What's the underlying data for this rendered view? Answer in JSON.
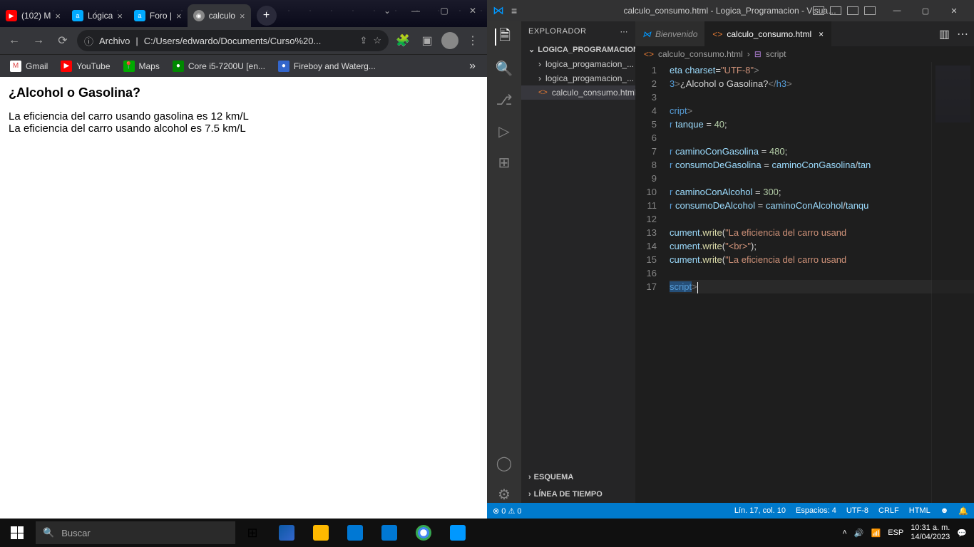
{
  "chrome": {
    "tabs": [
      {
        "title": "(102) M",
        "icon": "yt"
      },
      {
        "title": "Lógica",
        "icon": "alura"
      },
      {
        "title": "Foro |",
        "icon": "alura"
      },
      {
        "title": "calculo",
        "icon": "glob",
        "active": true
      }
    ],
    "address": {
      "scheme": "Archivo",
      "url": "C:/Users/edwardo/Documents/Curso%20..."
    },
    "bookmarks": [
      {
        "label": "Gmail",
        "icon": "gm"
      },
      {
        "label": "YouTube",
        "icon": "yt2"
      },
      {
        "label": "Maps",
        "icon": "mp"
      },
      {
        "label": "Core i5-7200U [en...",
        "icon": "ci"
      },
      {
        "label": "Fireboy and Waterg...",
        "icon": "fb"
      }
    ],
    "page": {
      "heading": "¿Alcohol o Gasolina?",
      "line1": "La eficiencia del carro usando gasolina es 12 km/L",
      "line2": "La eficiencia del carro usando alcohol es 7.5 km/L"
    }
  },
  "vscode": {
    "title": "calculo_consumo.html - Logica_Programacion - Visual Stu...",
    "explorer": {
      "title": "EXPLORADOR",
      "project": "LOGICA_PROGRAMACION",
      "files": [
        {
          "name": "logica_progamacion_..."
        },
        {
          "name": "logica_progamacion_..."
        },
        {
          "name": "calculo_consumo.html",
          "active": true
        }
      ],
      "outline": "ESQUEMA",
      "timeline": "LÍNEA DE TIEMPO"
    },
    "editor_tabs": [
      {
        "label": "Bienvenido",
        "icon": "vs"
      },
      {
        "label": "calculo_consumo.html",
        "icon": "html",
        "active": true
      }
    ],
    "breadcrumb": {
      "file": "calculo_consumo.html",
      "symbol": "script"
    },
    "code": {
      "lines": [
        {
          "n": 1,
          "html": "<span class='c-attr'>eta</span> <span class='c-attr'>charset</span><span class='c-op'>=</span><span class='c-str'>\"UTF-8\"</span><span class='c-tag'>&gt;</span>"
        },
        {
          "n": 2,
          "html": "<span class='c-tagn'>3</span><span class='c-tag'>&gt;</span><span class='c-text'>¿Alcohol o Gasolina?</span><span class='c-tag'>&lt;/</span><span class='c-tagn'>h3</span><span class='c-tag'>&gt;</span>"
        },
        {
          "n": 3,
          "html": ""
        },
        {
          "n": 4,
          "html": "<span class='c-tagn'>cript</span><span class='c-tag'>&gt;</span>"
        },
        {
          "n": 5,
          "html": "<span class='c-kw'>r</span> <span class='c-var'>tanque</span> <span class='c-op'>=</span> <span class='c-num'>40</span><span class='c-op'>;</span>"
        },
        {
          "n": 6,
          "html": ""
        },
        {
          "n": 7,
          "html": "<span class='c-kw'>r</span> <span class='c-var'>caminoConGasolina</span> <span class='c-op'>=</span> <span class='c-num'>480</span><span class='c-op'>;</span>"
        },
        {
          "n": 8,
          "html": "<span class='c-kw'>r</span> <span class='c-var'>consumoDeGasolina</span> <span class='c-op'>=</span> <span class='c-var'>caminoConGasolina</span><span class='c-op'>/</span><span class='c-var'>tan</span>"
        },
        {
          "n": 9,
          "html": ""
        },
        {
          "n": 10,
          "html": "<span class='c-kw'>r</span> <span class='c-var'>caminoConAlcohol</span> <span class='c-op'>=</span> <span class='c-num'>300</span><span class='c-op'>;</span>"
        },
        {
          "n": 11,
          "html": "<span class='c-kw'>r</span> <span class='c-var'>consumoDeAlcohol</span> <span class='c-op'>=</span> <span class='c-var'>caminoConAlcohol</span><span class='c-op'>/</span><span class='c-var'>tanqu</span>"
        },
        {
          "n": 12,
          "html": ""
        },
        {
          "n": 13,
          "html": "<span class='c-obj'>cument</span><span class='c-op'>.</span><span class='c-fn'>write</span><span class='c-op'>(</span><span class='c-str'>\"La eficiencia del carro usand</span>"
        },
        {
          "n": 14,
          "html": "<span class='c-obj'>cument</span><span class='c-op'>.</span><span class='c-fn'>write</span><span class='c-op'>(</span><span class='c-str'>\"&lt;br&gt;\"</span><span class='c-op'>);</span>"
        },
        {
          "n": 15,
          "html": "<span class='c-obj'>cument</span><span class='c-op'>.</span><span class='c-fn'>write</span><span class='c-op'>(</span><span class='c-str'>\"La eficiencia del carro usand</span>"
        },
        {
          "n": 16,
          "html": ""
        },
        {
          "n": 17,
          "html": "<span class='c-tagn' style='background:#264f78'>script</span><span class='c-tag'>&gt;</span><span style='border-left:1px solid #fff;height:16px;display:inline-block;vertical-align:middle'></span>",
          "cursor": true
        }
      ]
    },
    "status": {
      "errors": "⊗ 0 ⚠ 0",
      "position": "Lín. 17, col. 10",
      "spaces": "Espacios: 4",
      "encoding": "UTF-8",
      "eol": "CRLF",
      "lang": "HTML"
    }
  },
  "taskbar": {
    "search_placeholder": "Buscar",
    "time": "10:31 a. m.",
    "date": "14/04/2023"
  }
}
